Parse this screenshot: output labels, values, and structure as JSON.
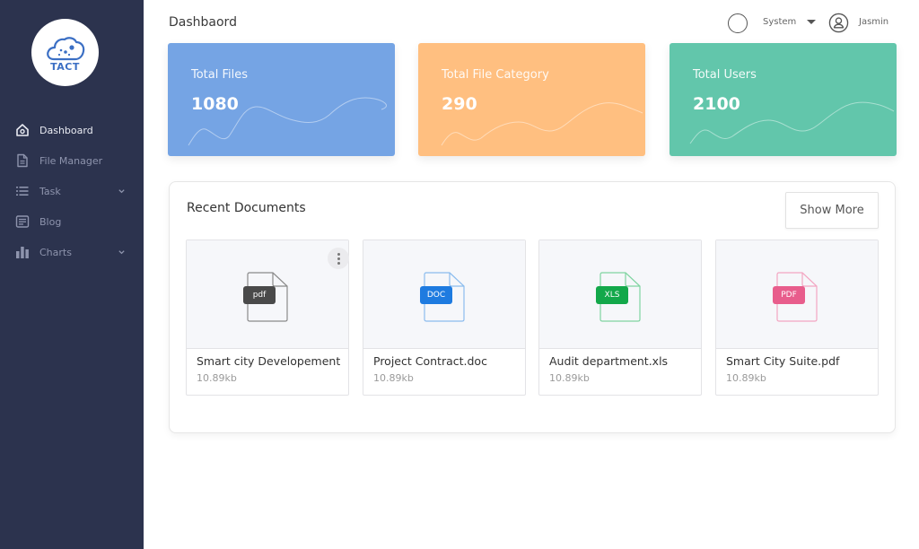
{
  "app": {
    "logo_text": "TACT",
    "page_title": "Dashbaord"
  },
  "sidebar": {
    "items": [
      {
        "label": "Dashboard",
        "icon": "home-icon",
        "active": true,
        "expandable": false
      },
      {
        "label": "File Manager",
        "icon": "file-icon",
        "active": false,
        "expandable": false
      },
      {
        "label": "Task",
        "icon": "list-icon",
        "active": false,
        "expandable": true
      },
      {
        "label": "Blog",
        "icon": "blog-icon",
        "active": false,
        "expandable": false
      },
      {
        "label": "Charts",
        "icon": "bar-chart-icon",
        "active": false,
        "expandable": true
      }
    ]
  },
  "header": {
    "theme_selector": "System",
    "user_name": "Jasmin"
  },
  "stats": [
    {
      "label": "Total Files",
      "value": "1080",
      "color": "#75a4e4"
    },
    {
      "label": "Total File Category",
      "value": "290",
      "color": "#ffbf80"
    },
    {
      "label": "Total Users",
      "value": "2100",
      "color": "#62c6ab"
    }
  ],
  "recent": {
    "title": "Recent Documents",
    "show_more_label": "Show More",
    "documents": [
      {
        "name": "Smart city Developement",
        "size": "10.89kb",
        "badge": "pdf",
        "badge_color": "#4a4a4a",
        "outline_color": "#8a8a8a"
      },
      {
        "name": "Project Contract.doc",
        "size": "10.89kb",
        "badge": "DOC",
        "badge_color": "#1e7be0",
        "outline_color": "#8bbcee"
      },
      {
        "name": "Audit department.xls",
        "size": "10.89kb",
        "badge": "XLS",
        "badge_color": "#13a84a",
        "outline_color": "#7fd4a0"
      },
      {
        "name": "Smart City Suite.pdf",
        "size": "10.89kb",
        "badge": "PDF",
        "badge_color": "#e85d8c",
        "outline_color": "#f3a6c2"
      }
    ]
  }
}
